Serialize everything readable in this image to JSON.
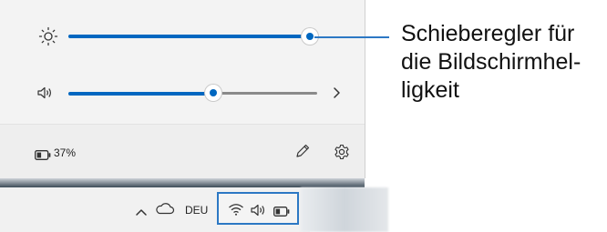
{
  "panel": {
    "brightness": {
      "icon": "sun-icon",
      "level": 0.96
    },
    "volume": {
      "icon": "speaker-icon",
      "level": 0.57,
      "expand_icon": "chevron-right-icon"
    },
    "battery": {
      "icon": "battery-icon",
      "text": "37%"
    },
    "edit_icon": "pencil-icon",
    "settings_icon": "gear-icon"
  },
  "taskbar": {
    "overflow_icon": "chevron-up-icon",
    "cloud_icon": "cloud-icon",
    "language": "DEU",
    "wifi_icon": "wifi-icon",
    "volume_icon": "speaker-icon",
    "battery_icon": "battery-icon"
  },
  "callout": {
    "lines": [
      "Schieberegler für",
      "die Bildschirmhel-",
      "ligkeit"
    ]
  },
  "colors": {
    "accent": "#0067c0",
    "callout": "#2c78c4"
  }
}
